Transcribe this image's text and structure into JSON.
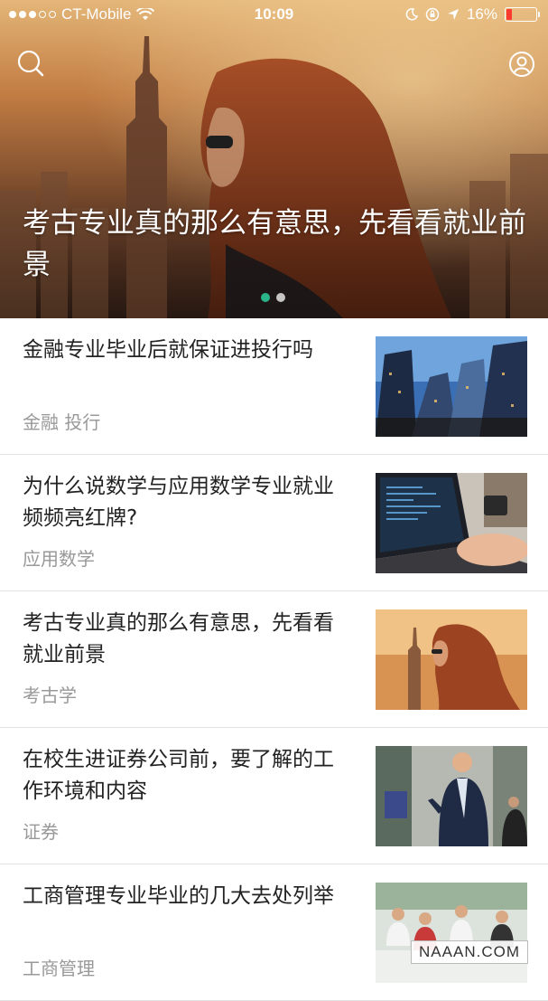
{
  "status_bar": {
    "carrier": "CT-Mobile",
    "time": "10:09",
    "battery": "16%",
    "battery_level": 0.16
  },
  "hero": {
    "title": "考古专业真的那么有意思，先看看就业前景",
    "pager_total": 2,
    "pager_active": 0
  },
  "articles": [
    {
      "title": "金融专业毕业后就保证进投行吗",
      "tag": "金融  投行",
      "image": "city-skyscrapers"
    },
    {
      "title": "为什么说数学与应用数学专业就业频频亮红牌?",
      "tag": "应用数学",
      "image": "laptop-coding"
    },
    {
      "title": "考古专业真的那么有意思，先看看就业前景",
      "tag": "考古学",
      "image": "woman-sunset-city"
    },
    {
      "title": "在校生进证券公司前，要了解的工作环境和内容",
      "tag": "证券",
      "image": "businessman-phone-street"
    },
    {
      "title": "工商管理专业毕业的几大去处列举",
      "tag": "工商管理",
      "image": "office-meeting"
    }
  ],
  "watermark": "NAAAN.COM",
  "colors": {
    "accent": "#2bb38a",
    "battery_low": "#ff3b30"
  }
}
